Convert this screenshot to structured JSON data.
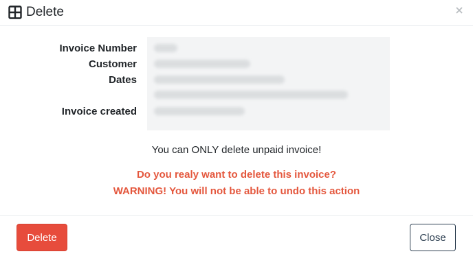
{
  "header": {
    "title": "Delete",
    "title_icon": "table-grid-icon",
    "close_icon": "close-icon"
  },
  "details": {
    "labels": [
      "Invoice Number",
      "Customer",
      "Dates",
      "Invoice created"
    ],
    "values_redacted": true
  },
  "notice": "You can ONLY delete unpaid invoice!",
  "warning": {
    "line1": "Do you realy want to delete this invoice?",
    "line2": "WARNING! You will not be able to undo this action",
    "color": "#e4573d"
  },
  "footer": {
    "delete_label": "Delete",
    "close_label": "Close"
  },
  "colors": {
    "delete_button": "#e74c3c",
    "close_button_border": "#2c3e50"
  }
}
